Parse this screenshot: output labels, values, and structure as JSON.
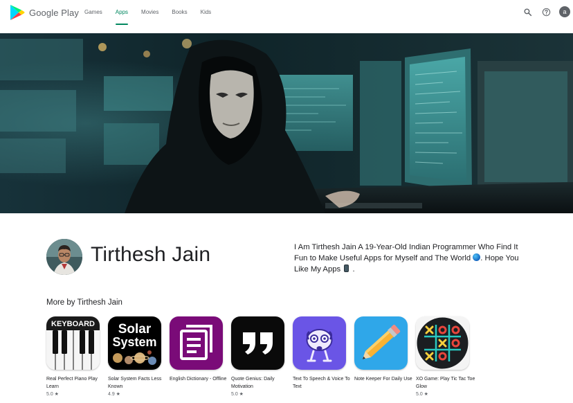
{
  "header": {
    "logo_text": "Google Play",
    "nav": [
      {
        "label": "Games",
        "active": false
      },
      {
        "label": "Apps",
        "active": true
      },
      {
        "label": "Movies",
        "active": false
      },
      {
        "label": "Books",
        "active": false
      },
      {
        "label": "Kids",
        "active": false
      }
    ],
    "icons": [
      "search-icon",
      "help-icon"
    ],
    "account_initial": "a",
    "accent_color": "#01875f"
  },
  "developer": {
    "name": "Tirthesh Jain",
    "about_part1": "I Am Tirthesh Jain A 19-Year-Old Indian Programmer Who Find It Fun to Make Useful Apps for Myself and The World",
    "about_part2": ". Hope You Like My Apps",
    "about_part3": "."
  },
  "more_by": {
    "title": "More by Tirthesh Jain",
    "apps": [
      {
        "name": "Real Perfect Piano Play Learn",
        "rating": "5.0 ★",
        "icon": "keyboard-icon",
        "icon_text": "KEYBOARD"
      },
      {
        "name": "Solar System Facts Less Known",
        "rating": "4.9 ★",
        "icon": "solar-system-icon",
        "icon_text": "Solar System"
      },
      {
        "name": "English Dictionary - Offline",
        "rating": "",
        "icon": "dictionary-icon"
      },
      {
        "name": "Quote Genius: Daily Motivation",
        "rating": "5.0 ★",
        "icon": "quote-icon"
      },
      {
        "name": "Text To Speech & Voice To Text",
        "rating": "",
        "icon": "speech-bot-icon"
      },
      {
        "name": "Note Keeper For Daily Use",
        "rating": "",
        "icon": "pencil-icon"
      },
      {
        "name": "XO Game: Play Tic Tac Toe Glow",
        "rating": "5.0 ★",
        "icon": "tic-tac-toe-icon"
      }
    ]
  }
}
